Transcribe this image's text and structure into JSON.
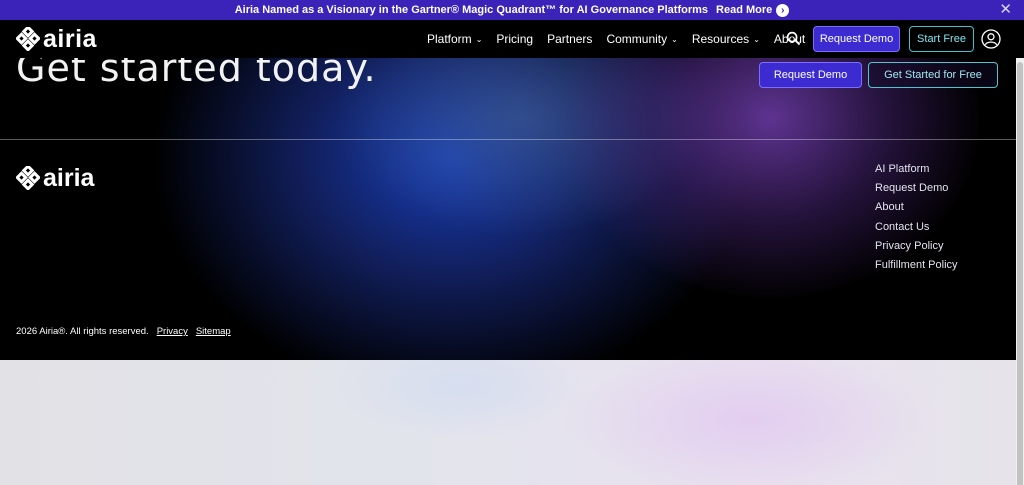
{
  "announcement": {
    "text": "Airia Named as a Visionary in the Gartner® Magic Quadrant™ for AI Governance Platforms",
    "read_more": "Read More",
    "arrow_icon": "arrow-right-circle-icon",
    "close_icon": "close-icon"
  },
  "header": {
    "logo_text": "airia",
    "nav": [
      {
        "label": "Platform",
        "dropdown": true
      },
      {
        "label": "Pricing",
        "dropdown": false
      },
      {
        "label": "Partners",
        "dropdown": false
      },
      {
        "label": "Community",
        "dropdown": true
      },
      {
        "label": "Resources",
        "dropdown": true
      },
      {
        "label": "About",
        "dropdown": false
      }
    ],
    "request_demo": "Request Demo",
    "start_free": "Start Free"
  },
  "hero": {
    "title": "Get started today.",
    "request_demo": "Request Demo",
    "get_started": "Get Started for Free"
  },
  "footer": {
    "logo_text": "airia",
    "links": [
      "AI Platform",
      "Request Demo",
      "About",
      "Contact Us",
      "Privacy Policy",
      "Fulfillment Policy"
    ],
    "copyright": "2026 Airia®. All rights reserved.",
    "privacy": "Privacy",
    "sitemap": "Sitemap"
  },
  "colors": {
    "brand_purple": "#3b22b8",
    "button_blue": "#3b2bd0",
    "accent_cyan": "#3fc3d0"
  }
}
